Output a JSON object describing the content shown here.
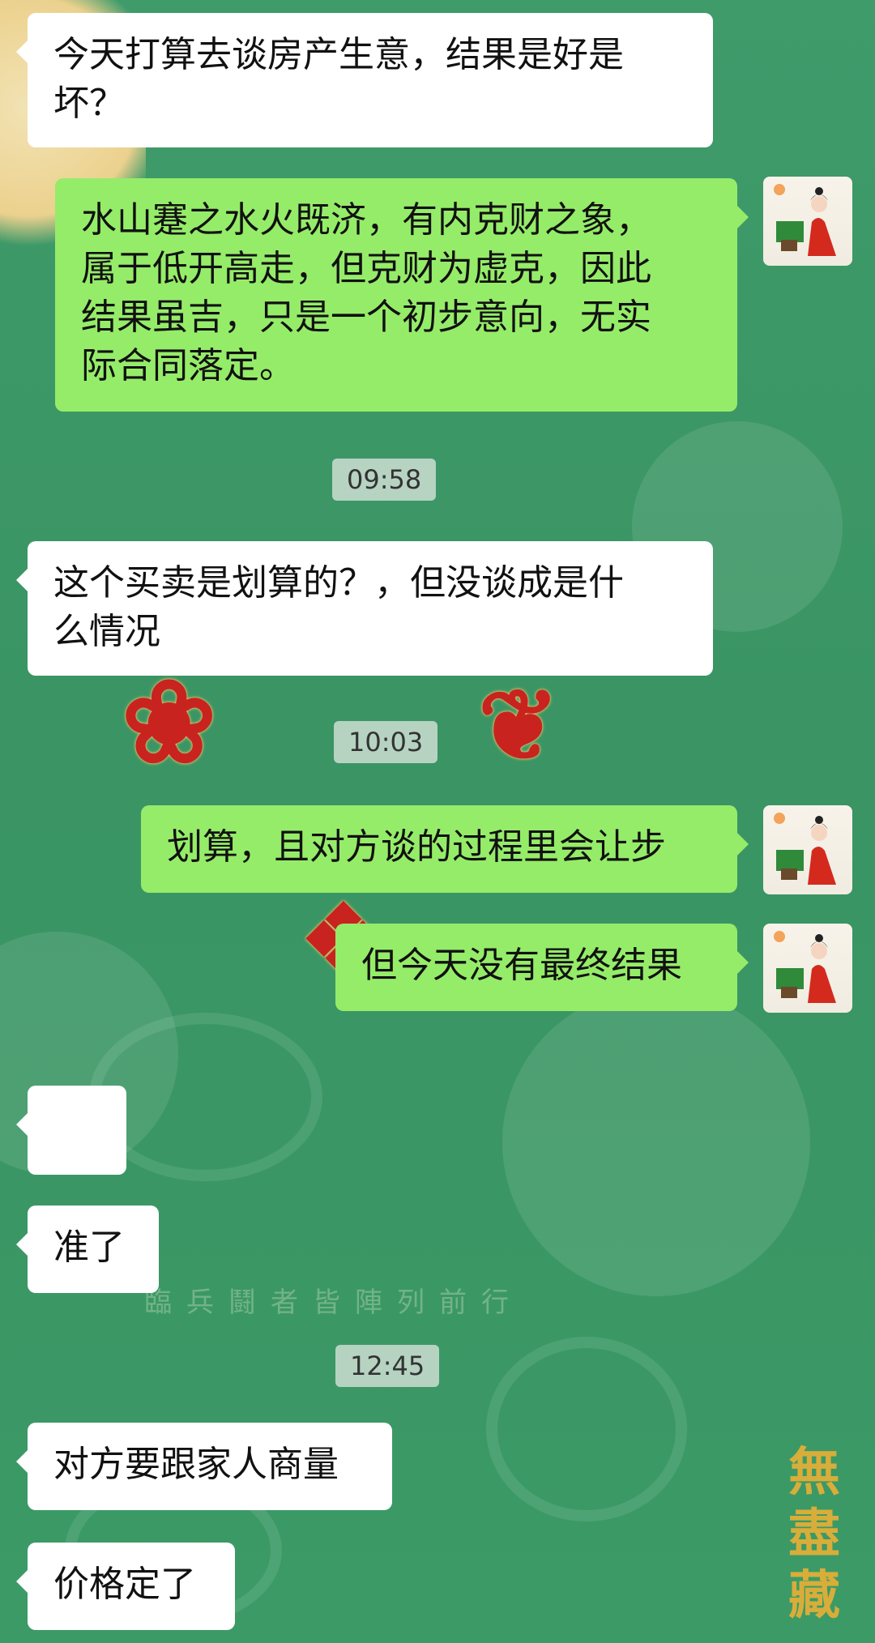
{
  "messages": [
    {
      "side": "left",
      "text": "今天打算去谈房产生意，结果是好是\n坏？"
    },
    {
      "side": "right",
      "text": "水山蹇之水火既济，有内克财之象，\n属于低开高走，但克财为虚克，因此\n结果虽吉，只是一个初步意向，无实\n际合同落定。"
    },
    {
      "side": "left",
      "text": "这个买卖是划算的？，但没谈成是什\n么情况"
    },
    {
      "side": "right",
      "text": "划算，且对方谈的过程里会让步"
    },
    {
      "side": "right",
      "text": "但今天没有最终结果"
    },
    {
      "side": "left",
      "text": "👍"
    },
    {
      "side": "left",
      "text": "准了"
    },
    {
      "side": "left",
      "text": "对方要跟家人商量"
    },
    {
      "side": "left",
      "text": "价格定了"
    }
  ],
  "times": [
    "09:58",
    "10:03",
    "12:45"
  ],
  "background": {
    "watermark": "臨兵鬪者皆陣列前行",
    "signature": "無盡藏",
    "colors": {
      "base": "#3b9a66",
      "self_bubble": "#95ec69",
      "other_bubble": "#ffffff"
    }
  },
  "avatar_icon": "woman-in-red-hanfu-avatar"
}
